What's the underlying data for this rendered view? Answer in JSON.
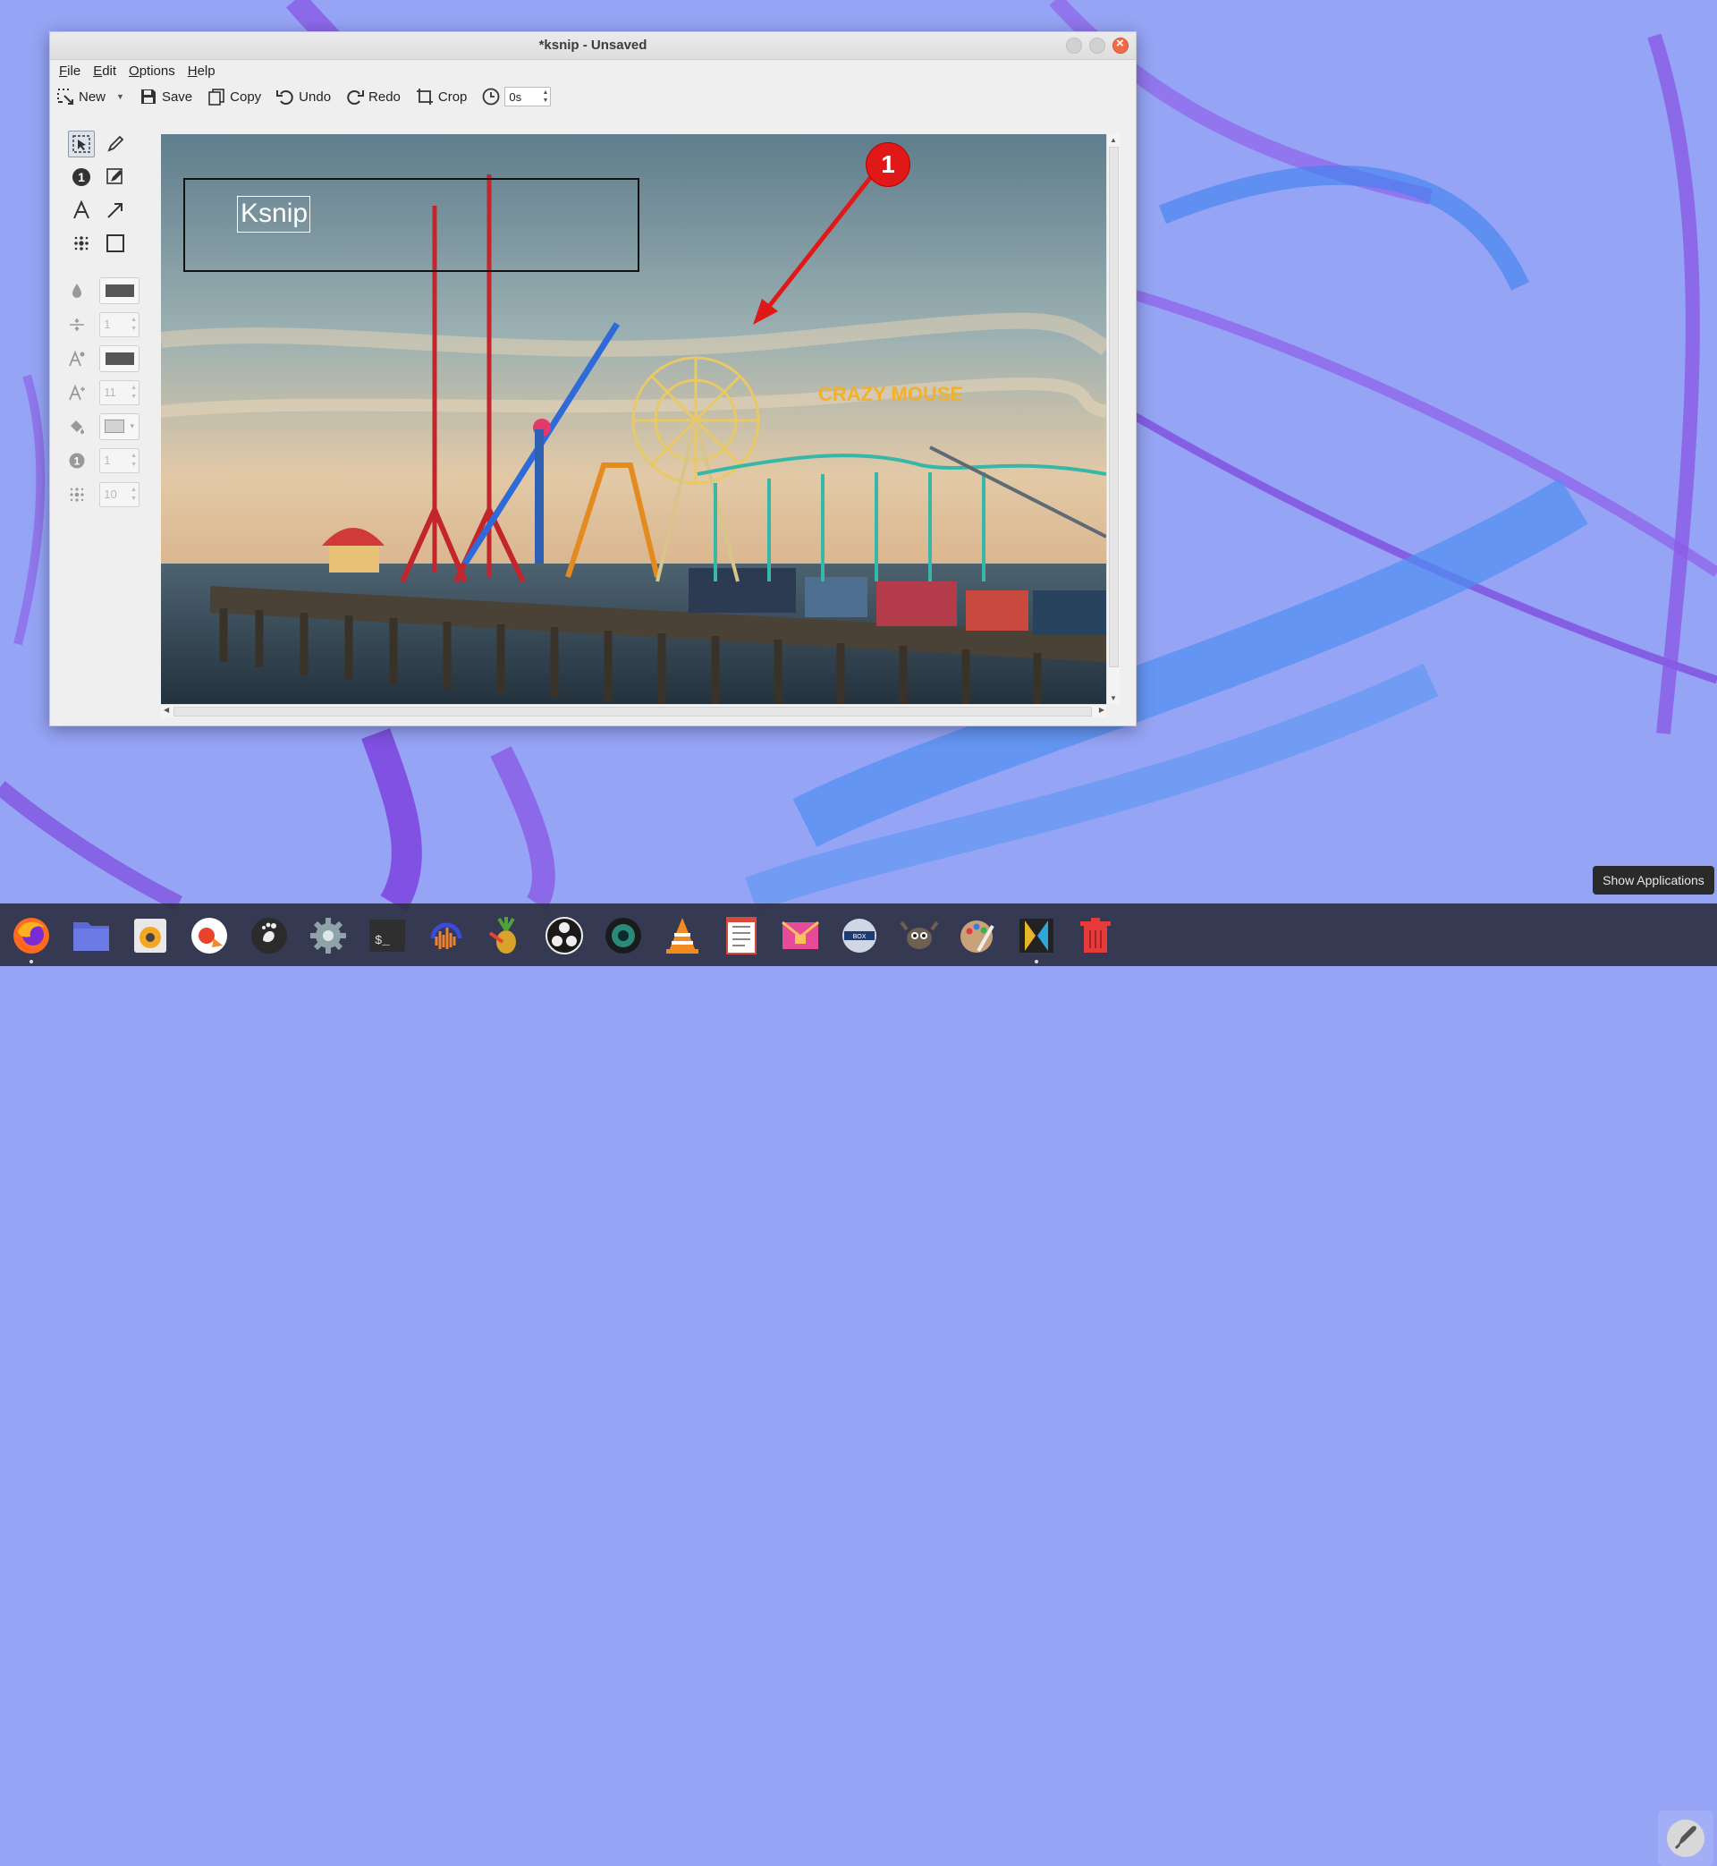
{
  "window": {
    "title": "*ksnip - Unsaved"
  },
  "menubar": {
    "items": [
      "File",
      "Edit",
      "Options",
      "Help"
    ]
  },
  "toolbar": {
    "new_label": "New",
    "save_label": "Save",
    "copy_label": "Copy",
    "undo_label": "Undo",
    "redo_label": "Redo",
    "crop_label": "Crop",
    "delay_value": "0s"
  },
  "tools": {
    "items": [
      "select-tool",
      "pen-tool",
      "number-tool",
      "marker-tool",
      "text-tool",
      "arrow-tool",
      "blur-tool",
      "rectangle-tool"
    ],
    "selected": "select-tool"
  },
  "properties": {
    "color": "#575757",
    "width_value": "1",
    "text_color": "#575757",
    "font_size_value": "11",
    "fill_color": "#d3d3d3",
    "number_value": "1",
    "blur_value": "10"
  },
  "canvas": {
    "text_annotation": "Ksnip",
    "number_badge": "1",
    "sign_text": "CRAZY MOUSE"
  },
  "tooltip": {
    "text": "Show Applications"
  },
  "dock": {
    "apps": [
      "firefox",
      "files",
      "rhythmbox",
      "openshot",
      "gnome",
      "settings",
      "terminal",
      "audacity",
      "pineapple",
      "obs",
      "camera",
      "vlc",
      "notes",
      "mail",
      "boxes",
      "gimp",
      "paint",
      "kdenlive",
      "trash",
      "show-applications"
    ]
  }
}
